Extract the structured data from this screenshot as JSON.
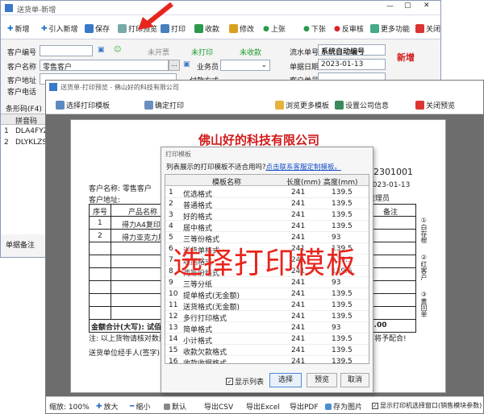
{
  "main": {
    "title": "送货单-新增",
    "toolbar": [
      "新增",
      "引入新增",
      "保存",
      "打印预览",
      "打印",
      "收款",
      "修改",
      "上张",
      "下张",
      "反审核",
      "更多功能",
      "关闭"
    ],
    "status": [
      "未开票",
      "未打印",
      "未收款"
    ],
    "serial_label": "流水单号",
    "serial_value": "系统自动编号",
    "new_tag": "新增",
    "customer_code_label": "客户编号",
    "customer_name_label": "客户名称",
    "customer_name_value": "零售客户",
    "salesman_label": "业务员",
    "date_label": "单据日期",
    "date_value": "2023-01-13",
    "address_label": "客户地址",
    "pay_label": "付款方式",
    "custno_label": "客户单号",
    "phone_label": "客户电话",
    "barcode_label": "条形码(F4)",
    "col_pinyin": "拼音码",
    "rows": [
      {
        "n": "1",
        "code": "DLA4FYZH"
      },
      {
        "n": "2",
        "code": "DLYKLZSJ"
      }
    ],
    "remark_label": "单据备注"
  },
  "preview": {
    "title": "送货单-打印预览 - 佛山好的科技有限公司",
    "toolbar": [
      "选择打印模板",
      "确定打印",
      "浏览更多模板",
      "设置公司信息",
      "关闭预览"
    ],
    "company": "佛山好的科技有限公司",
    "doc_no": "02301001",
    "doc_date": "2023-01-13",
    "handler": "管理员",
    "cust_name": "客户名称: 零售客户",
    "cust_addr": "客户地址:",
    "cols": [
      "序号",
      "产品名称"
    ],
    "remark_col": "备注",
    "items": [
      {
        "n": "1",
        "name": "得力A4复印纸"
      },
      {
        "n": "2",
        "name": "得力亚克力展"
      }
    ],
    "total": "金额合计(大写): 试佰",
    "total_num": "39.00",
    "note": "注: 以上货物请核对数量,",
    "note_end": "将予配合!",
    "sign": "送货单位经手人(签字)",
    "copies": [
      "①白存根",
      "②红客户",
      "③黄回单"
    ],
    "bottom": [
      "缩放: 100%",
      "放大",
      "缩小",
      "默认",
      "导出CSV",
      "导出Excel",
      "导出PDF",
      "存为图片"
    ],
    "bottom_check": "显示打印机选择窗口(销售模块参数)"
  },
  "dialog": {
    "title": "打印模板",
    "hint": "列表展示的打印模板不适合用吗?",
    "link": "点击联系客服定制模板。",
    "headers": [
      "模板名称",
      "长度(mm)",
      "高度(mm)"
    ],
    "rows": [
      [
        "1",
        "优选格式",
        "241",
        "139.5"
      ],
      [
        "2",
        "普通格式",
        "241",
        "139.5"
      ],
      [
        "3",
        "好的格式",
        "241",
        "139.5"
      ],
      [
        "4",
        "居中格式",
        "241",
        "139.5"
      ],
      [
        "5",
        "三等份格式",
        "241",
        "93"
      ],
      [
        "6",
        "送货单格式",
        "241",
        "139.5"
      ],
      [
        "7",
        "收据格式",
        "241",
        "139.5"
      ],
      [
        "8",
        "两等份格式",
        "241",
        "139.5"
      ],
      [
        "9",
        "三等分纸",
        "241",
        "93"
      ],
      [
        "10",
        "提单格式(无金额)",
        "241",
        "139.5"
      ],
      [
        "11",
        "送货格式(无金额)",
        "241",
        "139.5"
      ],
      [
        "12",
        "多行打印格式",
        "241",
        "139.5"
      ],
      [
        "13",
        "简单格式",
        "241",
        "93"
      ],
      [
        "14",
        "小计格式",
        "241",
        "139.5"
      ],
      [
        "15",
        "收款欠款格式",
        "241",
        "139.5"
      ],
      [
        "16",
        "收款收据格式",
        "241",
        "139.5"
      ]
    ],
    "show_list": "显示列表",
    "buttons": [
      "选择",
      "预览",
      "取消"
    ]
  },
  "overlay": "选择打印模板",
  "colors": {
    "accent_red": "#e8251d",
    "brand_red": "#d21919"
  }
}
